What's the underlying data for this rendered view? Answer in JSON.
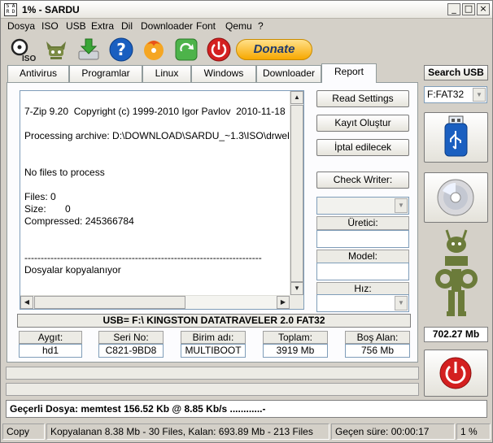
{
  "window": {
    "title": "1% - SARDU",
    "app_icon_chars": [
      "S",
      "A",
      "R",
      "D"
    ]
  },
  "menu": [
    "Dosya",
    "ISO",
    "USB",
    "Extra",
    "Dil",
    "Downloader",
    "Font",
    "Qemu",
    "?"
  ],
  "toolbar": {
    "iso_icon_label": "ISO",
    "donate_label": "Donate"
  },
  "tabs": [
    {
      "label": "Antivirus",
      "active": false
    },
    {
      "label": "Programlar",
      "active": false
    },
    {
      "label": "Linux",
      "active": false
    },
    {
      "label": "Windows",
      "active": false
    },
    {
      "label": "Downloader",
      "active": false
    },
    {
      "label": "Report",
      "active": true
    }
  ],
  "report": {
    "text": "7-Zip 9.20  Copyright (c) 1999-2010 Igor Pavlov  2010-11-18\n\nProcessing archive: D:\\DOWNLOAD\\SARDU_~1.3\\ISO\\drweb\n\n\nNo files to process\n\nFiles: 0\nSize:       0\nCompressed: 245366784\n\n\n-------------------------------------------------------------------------\nDosyalar kopyalanıyor"
  },
  "panel_buttons": {
    "read_settings": "Read Settings",
    "create_log": "Kayıt Oluştur",
    "cancel": "İptal edilecek",
    "check_writer": "Check Writer:"
  },
  "writer_fields": {
    "manufacturer_label": "Üretici:",
    "model_label": "Model:",
    "speed_label": "Hız:"
  },
  "usb_info": {
    "summary": "USB= F:\\ KINGSTON DATATRAVELER 2.0 FAT32",
    "fields": [
      {
        "label": "Aygıt:",
        "value": "hd1"
      },
      {
        "label": "Seri No:",
        "value": "C821-9BD8"
      },
      {
        "label": "Birim adı:",
        "value": "MULTIBOOT"
      },
      {
        "label": "Toplam:",
        "value": "3919 Mb"
      },
      {
        "label": "Boş Alan:",
        "value": "756 Mb"
      }
    ]
  },
  "current_file": "Geçerli Dosya: memtest 156.52 Kb @ 8.85 Kb/s ............-",
  "status": {
    "mode": "Copy",
    "copied": "Kopyalanan 8.38 Mb  - 30 Files,   Kalan: 693.89 Mb  - 213 Files",
    "elapsed": "Geçen süre: 00:00:17",
    "percent": "1 %"
  },
  "right_panel": {
    "search_usb_label": "Search USB",
    "drive_value": "F:FAT32",
    "size_label": "702.27 Mb"
  },
  "colors": {
    "accent_blue": "#1a5fc0",
    "power_red": "#d42020",
    "robot_green": "#6b7b3a",
    "donate_gold": "#f7a800"
  }
}
